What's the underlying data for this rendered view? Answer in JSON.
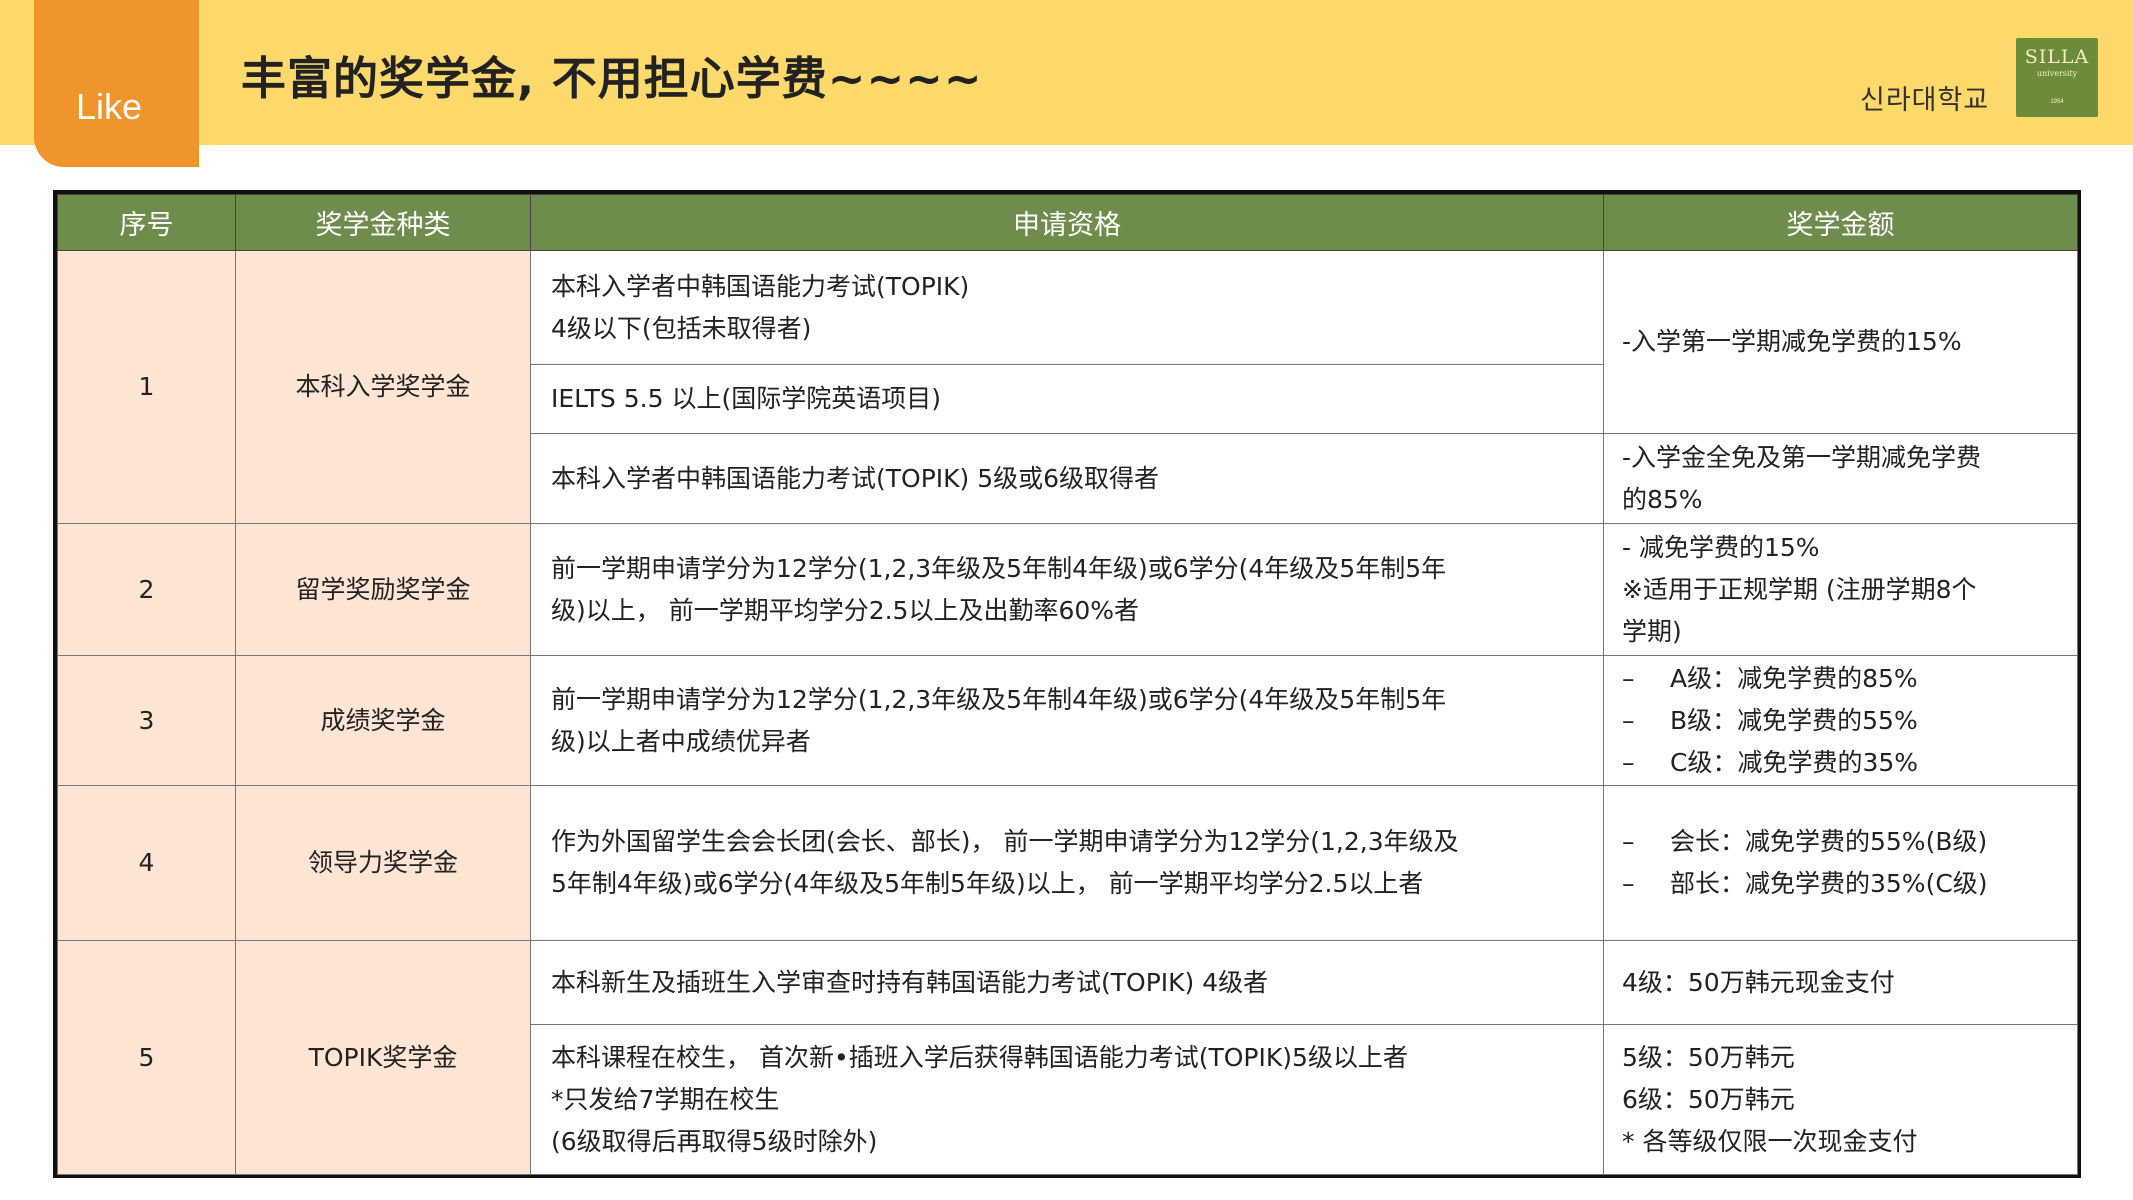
{
  "header": {
    "like_label": "Like",
    "title": "丰富的奖学金, 不用担心学费~~~~",
    "university_name": "신라대학교",
    "logo": {
      "main": "SILLA",
      "sub": "university",
      "year": "1954"
    }
  },
  "colors": {
    "header_band": "#fcd96a",
    "like_tab": "#f0952c",
    "table_header": "#6e8c4b",
    "category_cell": "#fde4d3",
    "logo_bg": "#6d8c3a"
  },
  "table": {
    "headers": [
      "序号",
      "奖学金种类",
      "申请资格",
      "奖学金额"
    ],
    "rows": [
      {
        "no": "1",
        "type": "本科入学奖学金",
        "eligibility": [
          [
            "本科入学者中韩国语能力考试(TOPIK)",
            "4级以下(包括未取得者)"
          ],
          [
            "IELTS 5.5 以上(国际学院英语项目)"
          ],
          [
            "本科入学者中韩国语能力考试(TOPIK) 5级或6级取得者"
          ]
        ],
        "amount": [
          [
            "-入学第一学期减免学费的15%"
          ],
          [
            "-入学金全免及第一学期减免学费",
            "的85%"
          ]
        ]
      },
      {
        "no": "2",
        "type": "留学奖励奖学金",
        "eligibility": [
          [
            "前一学期申请学分为12学分(1,2,3年级及5年制4年级)或6学分(4年级及5年制5年",
            "级)以上， 前一学期平均学分2.5以上及出勤率60%者"
          ]
        ],
        "amount": [
          [
            "- 减免学费的15%",
            "※适用于正规学期 (注册学期8个",
            "学期)"
          ]
        ]
      },
      {
        "no": "3",
        "type": "成绩奖学金",
        "eligibility": [
          [
            "前一学期申请学分为12学分(1,2,3年级及5年制4年级)或6学分(4年级及5年制5年",
            "级)以上者中成绩优异者"
          ]
        ],
        "amount": [
          [
            "A级：减免学费的85%",
            "B级：减免学费的55%",
            "C级：减免学费的35%"
          ]
        ]
      },
      {
        "no": "4",
        "type": "领导力奖学金",
        "eligibility": [
          [
            "作为外国留学生会会长团(会长、部长)， 前一学期申请学分为12学分(1,2,3年级及",
            "5年制4年级)或6学分(4年级及5年制5年级)以上， 前一学期平均学分2.5以上者"
          ]
        ],
        "amount": [
          [
            "会长：减免学费的55%(B级)",
            "部长：减免学费的35%(C级)"
          ]
        ]
      },
      {
        "no": "5",
        "type": "TOPIK奖学金",
        "eligibility": [
          [
            "本科新生及插班生入学审查时持有韩国语能力考试(TOPIK) 4级者"
          ],
          [
            "本科课程在校生， 首次新•插班入学后获得韩国语能力考试(TOPIK)5级以上者",
            "*只发给7学期在校生",
            "(6级取得后再取得5级时除外)"
          ]
        ],
        "amount": [
          [
            "4级：50万韩元现金支付"
          ],
          [
            "5级：50万韩元",
            "6级：50万韩元",
            "* 各等级仅限一次现金支付"
          ]
        ]
      }
    ]
  }
}
